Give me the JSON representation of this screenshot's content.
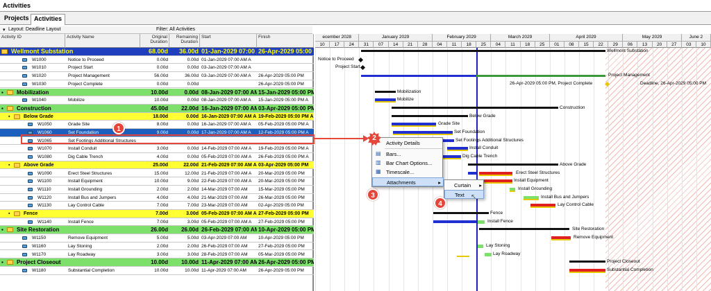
{
  "window": {
    "title": "Activities"
  },
  "tabs": [
    {
      "label": "Projects"
    },
    {
      "label": "Activities"
    }
  ],
  "toolbar": {
    "layout_label": "Layout: Deadline Layout",
    "filter_label": "Filter: All Activities"
  },
  "columns": {
    "id": "Activity ID",
    "name": "Activity Name",
    "orig": "Original Duration",
    "rem": "Remaining Duration",
    "start": "Start",
    "finish": "Finish"
  },
  "timescale": {
    "months": [
      "ecember 2028",
      "January 2029",
      "February 2029",
      "March 2029",
      "April 2029",
      "May 2029",
      "June 2"
    ],
    "days": [
      "10",
      "17",
      "24",
      "31",
      "07",
      "14",
      "21",
      "28",
      "04",
      "11",
      "18",
      "25",
      "04",
      "11",
      "18",
      "25",
      "01",
      "08",
      "15",
      "22",
      "29",
      "06",
      "13",
      "20",
      "27",
      "03",
      "10"
    ]
  },
  "rows": [
    {
      "level": "wbs0",
      "id": "Wellmont Substation",
      "name": "",
      "orig": "68.00d",
      "rem": "36.00d",
      "start": "01-Jan-2029 07:00 AM A",
      "finish": "26-Apr-2029 05:00 PM"
    },
    {
      "level": "act",
      "id": "W1000",
      "name": "Notice to Proceed",
      "orig": "0.00d",
      "rem": "0.00d",
      "start": "01-Jan-2029 07:00 AM A",
      "finish": ""
    },
    {
      "level": "act",
      "id": "W1010",
      "name": "Project Start",
      "orig": "0.00d",
      "rem": "0.00d",
      "start": "03-Jan-2029 07:00 AM A",
      "finish": ""
    },
    {
      "level": "act",
      "id": "W1020",
      "name": "Project Management",
      "orig": "56.00d",
      "rem": "36.00d",
      "start": "03-Jan-2029 07:00 AM A",
      "finish": "26-Apr-2029 05:00 PM"
    },
    {
      "level": "act",
      "id": "W1030",
      "name": "Project Complete",
      "orig": "0.00d",
      "rem": "0.00d",
      "start": "",
      "finish": "26-Apr-2029 05:00 PM"
    },
    {
      "level": "wbs1",
      "id": "Mobilization",
      "name": "",
      "orig": "10.00d",
      "rem": "0.00d",
      "start": "08-Jan-2029 07:00 AM A",
      "finish": "15-Jan-2029 05:00 PM A"
    },
    {
      "level": "act",
      "id": "W1040",
      "name": "Mobilize",
      "orig": "10.00d",
      "rem": "0.00d",
      "start": "08-Jan-2029 07:00 AM A",
      "finish": "15-Jan-2029 05:00 PM A"
    },
    {
      "level": "wbs1",
      "id": "Construction",
      "name": "",
      "orig": "45.00d",
      "rem": "22.00d",
      "start": "16-Jan-2029 07:00 AM A",
      "finish": "03-Apr-2029 05:00 PM"
    },
    {
      "level": "wbs2",
      "id": "Below Grade",
      "name": "",
      "orig": "18.00d",
      "rem": "0.00d",
      "start": "16-Jan-2029 07:00 AM A",
      "finish": "19-Feb-2029 05:00 PM A"
    },
    {
      "level": "act",
      "id": "W1050",
      "name": "Grade Site",
      "orig": "8.00d",
      "rem": "0.00d",
      "start": "16-Jan-2029 07:00 AM A",
      "finish": "05-Feb-2029 05:00 PM A"
    },
    {
      "level": "sel",
      "id": "W1060",
      "name": "Set Foundation",
      "orig": "9.00d",
      "rem": "0.00d",
      "start": "17-Jan-2029 07:00 AM A",
      "finish": "12-Feb-2029 05:00 PM A"
    },
    {
      "level": "act",
      "id": "W1065",
      "name": "Set Footings Additional Structures",
      "orig": "",
      "rem": "",
      "start": "",
      "finish": ""
    },
    {
      "level": "act",
      "id": "W1070",
      "name": "Install Conduit",
      "orig": "3.00d",
      "rem": "0.00d",
      "start": "14-Feb-2029 07:00 AM A",
      "finish": "19-Feb-2029 05:00 PM A"
    },
    {
      "level": "act",
      "id": "W1080",
      "name": "Dig Cable Trench",
      "orig": "4.00d",
      "rem": "0.00d",
      "start": "05-Feb-2029 07:00 AM A",
      "finish": "26-Feb-2029 05:00 PM A"
    },
    {
      "level": "wbs2",
      "id": "Above Grade",
      "name": "",
      "orig": "25.00d",
      "rem": "22.00d",
      "start": "21-Feb-2029 07:00 AM A",
      "finish": "03-Apr-2029 05:00 PM"
    },
    {
      "level": "act",
      "id": "W1090",
      "name": "Erect Steel Structures",
      "orig": "15.00d",
      "rem": "12.00d",
      "start": "21-Feb-2029 07:00 AM A",
      "finish": "20-Mar-2029 05:00 PM"
    },
    {
      "level": "act",
      "id": "W1100",
      "name": "Install Equipment",
      "orig": "10.00d",
      "rem": "9.00d",
      "start": "22-Feb-2029 07:00 AM A",
      "finish": "20-Mar-2029 05:00 PM"
    },
    {
      "level": "act",
      "id": "W1110",
      "name": "Install Grounding",
      "orig": "2.00d",
      "rem": "2.00d",
      "start": "14-Mar-2029 07:00 AM",
      "finish": "15-Mar-2029 05:00 PM"
    },
    {
      "level": "act",
      "id": "W1120",
      "name": "Install Bus and Jumpers",
      "orig": "4.00d",
      "rem": "4.00d",
      "start": "21-Mar-2029 07:00 AM",
      "finish": "26-Mar-2029 05:00 PM"
    },
    {
      "level": "act",
      "id": "W1130",
      "name": "Lay Control Cable",
      "orig": "7.00d",
      "rem": "7.00d",
      "start": "23-Mar-2029 07:00 AM",
      "finish": "02-Apr-2029 05:00 PM"
    },
    {
      "level": "wbs2",
      "id": "Fence",
      "name": "",
      "orig": "7.00d",
      "rem": "3.00d",
      "start": "05-Feb-2029 07:00 AM A",
      "finish": "27-Feb-2029 05:00 PM"
    },
    {
      "level": "act",
      "id": "W1140",
      "name": "Install Fence",
      "orig": "7.00d",
      "rem": "3.00d",
      "start": "05-Feb-2029 07:00 AM A",
      "finish": "27-Feb-2029 05:00 PM"
    },
    {
      "level": "wbs1",
      "id": "Site Restoration",
      "name": "",
      "orig": "26.00d",
      "rem": "26.00d",
      "start": "26-Feb-2029 07:00 AM",
      "finish": "10-Apr-2029 05:00 PM"
    },
    {
      "level": "act",
      "id": "W1150",
      "name": "Remove Equipment",
      "orig": "5.00d",
      "rem": "5.00d",
      "start": "03-Apr-2029 07:00 AM",
      "finish": "10-Apr-2029 05:00 PM"
    },
    {
      "level": "act",
      "id": "W1160",
      "name": "Lay Stoning",
      "orig": "2.00d",
      "rem": "2.00d",
      "start": "26-Feb-2029 07:00 AM",
      "finish": "27-Feb-2029 05:00 PM"
    },
    {
      "level": "act",
      "id": "W1170",
      "name": "Lay Roadway",
      "orig": "3.00d",
      "rem": "3.00d",
      "start": "28-Feb-2029 07:00 AM",
      "finish": "05-Mar-2029 05:00 PM"
    },
    {
      "level": "wbs1",
      "id": "Project Closeout",
      "name": "",
      "orig": "10.00d",
      "rem": "10.00d",
      "start": "11-Apr-2029 07:00 AM",
      "finish": "26-Apr-2029 05:00 PM"
    },
    {
      "level": "act",
      "id": "W1180",
      "name": "Substantial Completion",
      "orig": "10.00d",
      "rem": "10.00d",
      "start": "11-Apr-2029 07:00 AM",
      "finish": "26-Apr-2029 05:00 PM"
    }
  ],
  "bar_labels": {
    "wellmont": "Wellmont Substation",
    "ntp": "Notice to Proceed",
    "start": "Project Start",
    "pm": "Project Management",
    "complete": "26-Apr-2029 05:00 PM, Project Complete",
    "deadline": "Deadline, 26-Apr-2029 05:00 PM",
    "mob": "Mobilization",
    "mobilize": "Mobilize",
    "construction": "Construction",
    "below": "Below Grade",
    "grade": "Grade Site",
    "setfound": "Set Foundation",
    "footings": "Set Footings Additional Structures",
    "conduit": "Install Conduit",
    "trench": "Dig Cable Trench",
    "above": "Above Grade",
    "steel": "Erect Steel Structures",
    "equip": "Install Equipment",
    "ground": "Install Grounding",
    "bus": "Install Bus and Jumpers",
    "cable": "Lay Control Cable",
    "fence": "Fence",
    "instfence": "Install Fence",
    "siteres": "Site Restoration",
    "remove": "Remove Equipment",
    "stoning": "Lay Stoning",
    "roadway": "Lay Roadway",
    "closeout": "Project Closeout",
    "subst": "Substantial Completion"
  },
  "context_menu": {
    "items": [
      "Activity Details",
      "Bars...",
      "Bar Chart Options...",
      "Timescale...",
      "Attachments"
    ]
  },
  "submenu": {
    "items": [
      "Curtain",
      "Text"
    ]
  },
  "callouts": [
    "1",
    "2",
    "3",
    "4"
  ],
  "colors": {
    "wbs0": "#1f3fbf",
    "wbs1": "#7de06a",
    "wbs2": "#ffff33",
    "selected": "#1d5fbd",
    "critical": "#e02020",
    "actual": "#1f2fd0",
    "callout": "#e6453a"
  }
}
